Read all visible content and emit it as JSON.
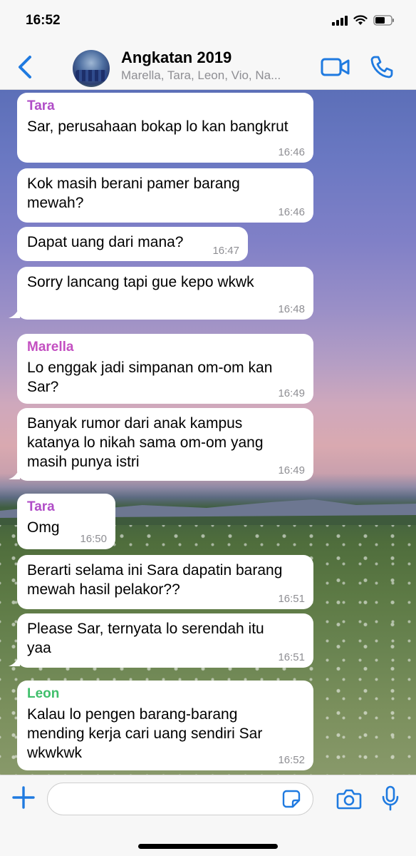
{
  "status": {
    "time": "16:52"
  },
  "header": {
    "title": "Angkatan 2019",
    "members": "Marella, Tara, Leon, Vio, Na...",
    "accent": "#1f7ae0"
  },
  "messages": [
    {
      "sender": "Tara",
      "sender_color": "#b04dc7",
      "text": "Sar, perusahaan bokap lo kan bangkrut",
      "time": "16:46"
    },
    {
      "sender": "",
      "text": "Kok masih berani pamer barang\nmewah?",
      "time": "16:46"
    },
    {
      "sender": "",
      "text": "Dapat uang dari mana?",
      "time": "16:47"
    },
    {
      "sender": "",
      "text": "Sorry lancang tapi gue kepo wkwk",
      "time": "16:48"
    },
    {
      "sender": "Marella",
      "sender_color": "#c34fc1",
      "text": "Lo enggak jadi simpanan om-om kan\nSar?",
      "time": "16:49"
    },
    {
      "sender": "",
      "text": "Banyak rumor dari anak kampus\nkatanya lo nikah sama om-om yang\nmasih punya istri",
      "time": "16:49"
    },
    {
      "sender": "Tara",
      "sender_color": "#b04dc7",
      "text": "Omg",
      "time": "16:50"
    },
    {
      "sender": "",
      "text": "Berarti selama ini Sara dapatin barang\nmewah hasil pelakor??",
      "time": "16:51"
    },
    {
      "sender": "",
      "text": "Please Sar, ternyata lo serendah itu\nyaa",
      "time": "16:51"
    },
    {
      "sender": "Leon",
      "sender_color": "#3fbf6b",
      "text": "Kalau lo pengen barang-barang\nmending kerja cari uang sendiri Sar\nwkwkwk",
      "time": "16:52"
    }
  ],
  "composer": {
    "placeholder": ""
  }
}
